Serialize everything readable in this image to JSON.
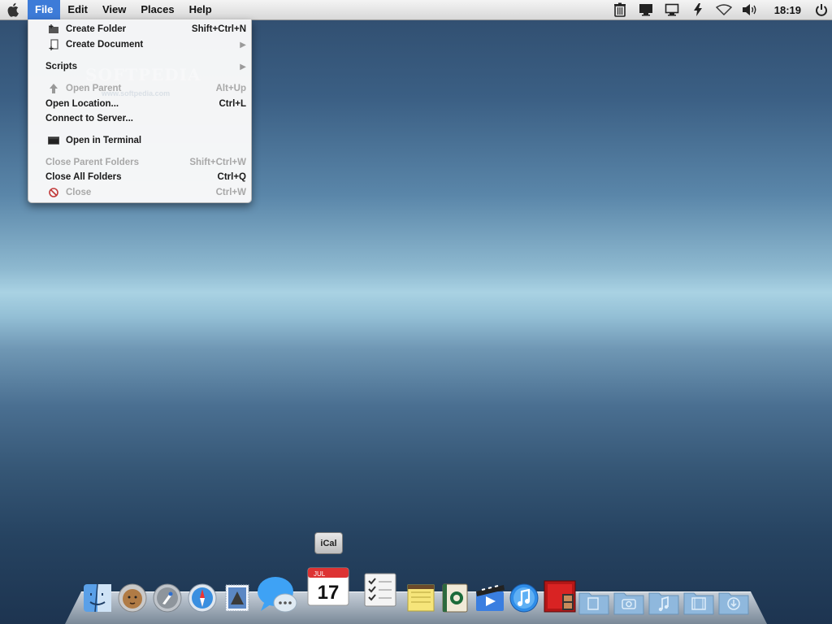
{
  "menubar": {
    "items": [
      "File",
      "Edit",
      "View",
      "Places",
      "Help"
    ],
    "active": "File",
    "clock": "18:19"
  },
  "file_menu": {
    "items": [
      {
        "label": "Create Folder",
        "shortcut": "Shift+Ctrl+N",
        "icon": "folder-add-icon",
        "enabled": true
      },
      {
        "label": "Create Document",
        "shortcut": "",
        "submenu": true,
        "icon": "document-add-icon",
        "enabled": true
      },
      {
        "label": "Scripts",
        "shortcut": "",
        "submenu": true,
        "enabled": true
      },
      {
        "label": "Open Parent",
        "shortcut": "Alt+Up",
        "icon": "up-arrow-icon",
        "enabled": false
      },
      {
        "label": "Open Location...",
        "shortcut": "Ctrl+L",
        "enabled": true
      },
      {
        "label": "Connect to Server...",
        "shortcut": "",
        "enabled": true
      },
      {
        "label": "Open in Terminal",
        "shortcut": "",
        "icon": "terminal-icon",
        "enabled": true
      },
      {
        "label": "Close Parent Folders",
        "shortcut": "Shift+Ctrl+W",
        "enabled": false
      },
      {
        "label": "Close All Folders",
        "shortcut": "Ctrl+Q",
        "enabled": true
      },
      {
        "label": "Close",
        "shortcut": "Ctrl+W",
        "icon": "close-circle-icon",
        "enabled": false
      }
    ]
  },
  "watermark": {
    "text": "SOFTPEDIA",
    "url": "www.softpedia.com"
  },
  "dock": {
    "tooltip": "iCal",
    "calendar": {
      "month": "JUL",
      "day": "17"
    },
    "apps": [
      "finder-icon",
      "mountain-lion-icon",
      "launchpad-icon",
      "safari-icon",
      "mail-stamp-icon",
      "messages-icon",
      "ical-icon",
      "reminders-icon",
      "notes-icon",
      "contacts-book-icon",
      "imovie-icon",
      "itunes-icon",
      "photo-booth-icon",
      "documents-folder-icon",
      "pictures-folder-icon",
      "music-folder-icon",
      "movies-folder-icon",
      "downloads-folder-icon"
    ]
  }
}
